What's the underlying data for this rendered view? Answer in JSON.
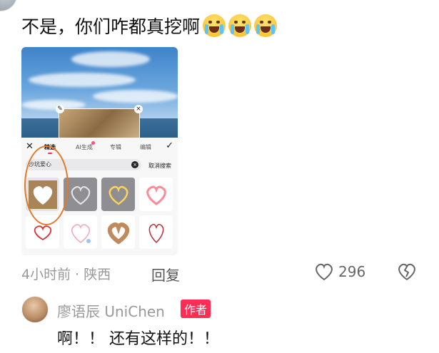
{
  "comment": {
    "text": "不是，你们咋都真挖啊",
    "emojis": [
      "crying-face-icon",
      "crying-face-icon",
      "crying-face-icon"
    ]
  },
  "screenshot": {
    "tabs": [
      "精选",
      "AI生成",
      "专辑",
      "编辑"
    ],
    "search_value": "沙坑爱心",
    "cancel_label": "取消搜索"
  },
  "meta": {
    "time_location": "4小时前 · 陕西",
    "reply_label": "回复",
    "like_count": "296"
  },
  "reply_comment": {
    "username": "廖语辰 UniChen",
    "badge": "作者",
    "text": "啊！！ 还有这样的！！"
  },
  "colors": {
    "accent": "#ff2d55",
    "annotation_circle": "#e07a2a",
    "muted_text": "#999999"
  }
}
